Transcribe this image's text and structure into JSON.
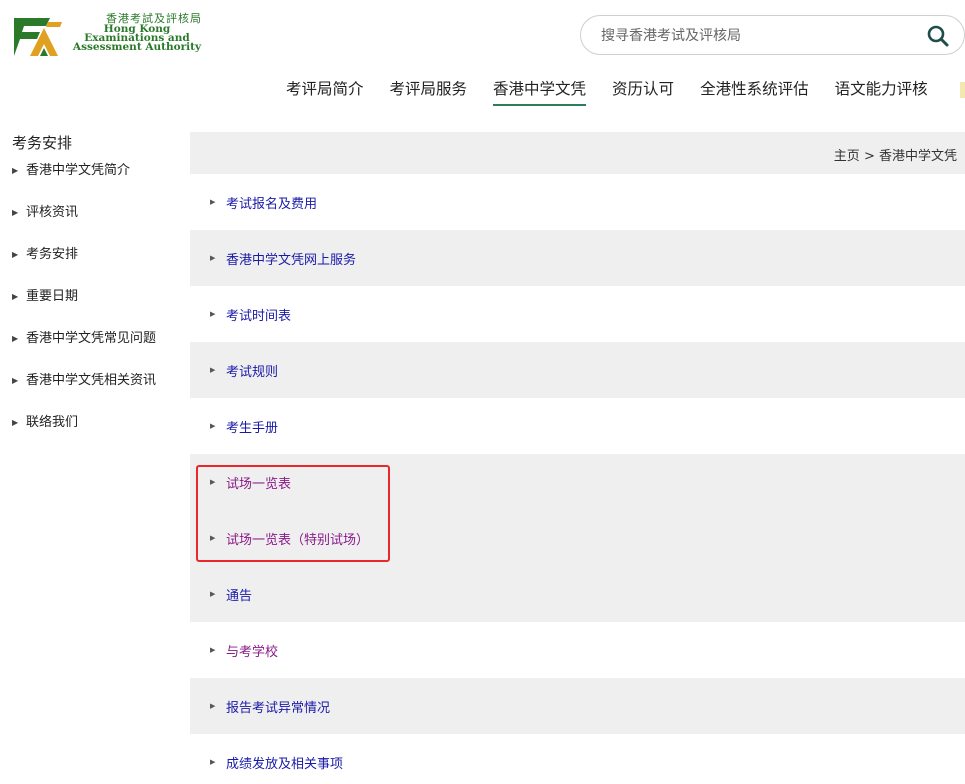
{
  "logo": {
    "zh": "香港考試及評核局",
    "en_line1": "Hong Kong",
    "en_line2": "Examinations and",
    "en_line3": "Assessment Authority"
  },
  "search": {
    "placeholder": "搜寻香港考试及评核局",
    "icon": "search-icon"
  },
  "nav": {
    "items": [
      {
        "label": "考评局简介"
      },
      {
        "label": "考评局服务"
      },
      {
        "label": "香港中学文凭",
        "active": true
      },
      {
        "label": "资历认可"
      },
      {
        "label": "全港性系统评估"
      },
      {
        "label": "语文能力评核"
      }
    ]
  },
  "sidebar": {
    "title": "考务安排",
    "items": [
      {
        "label": "香港中学文凭简介"
      },
      {
        "label": "评核资讯"
      },
      {
        "label": "考务安排"
      },
      {
        "label": "重要日期"
      },
      {
        "label": "香港中学文凭常见问题"
      },
      {
        "label": "香港中学文凭相关资讯"
      },
      {
        "label": "联络我们"
      }
    ]
  },
  "breadcrumb": {
    "home": "主页",
    "separator": ">",
    "current": "香港中学文凭"
  },
  "content": {
    "links": [
      {
        "label": "考试报名及费用",
        "visited": false
      },
      {
        "label": "香港中学文凭网上服务",
        "visited": false
      },
      {
        "label": "考试时间表",
        "visited": false
      },
      {
        "label": "考试规则",
        "visited": false
      },
      {
        "label": "考生手册",
        "visited": false
      },
      {
        "label": "试场一览表",
        "visited": true
      },
      {
        "label": "试场一览表（特别试场）",
        "visited": true
      },
      {
        "label": "通告",
        "visited": false
      },
      {
        "label": "与考学校",
        "visited": true
      },
      {
        "label": "报告考试异常情况",
        "visited": false
      },
      {
        "label": "成绩发放及相关事项",
        "visited": false
      }
    ]
  },
  "colors": {
    "brand_green": "#2a7a2a",
    "link": "#1a1aa8",
    "visited_link": "#8a1a8a",
    "highlight_box": "#e8282a",
    "row_alt_bg": "#efefef"
  }
}
